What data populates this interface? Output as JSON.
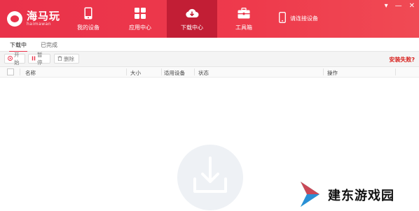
{
  "brand": {
    "name": "海马玩",
    "sub": "haimawan"
  },
  "nav": {
    "my_device": "我的设备",
    "app_center": "应用中心",
    "download_center": "下载中心",
    "toolbox": "工具箱",
    "connect_device": "请连接设备"
  },
  "window": {
    "menu_glyph": "▾",
    "minimize_glyph": "—",
    "close_glyph": "✕"
  },
  "tabs": {
    "downloading": "下载中",
    "completed": "已完成"
  },
  "toolbar": {
    "start": "开始",
    "pause": "暂停",
    "delete": "删除",
    "install_failed": "安装失败?"
  },
  "table": {
    "columns": {
      "name": "名称",
      "size": "大小",
      "device": "适用设备",
      "status": "状态",
      "action": "操作"
    }
  },
  "watermark": {
    "text": "建东游戏园"
  },
  "colors": {
    "accent": "#e9324a",
    "active_tab_bg": "#c21e35",
    "error_red": "#d8201c"
  },
  "icons": [
    "phone-icon",
    "apps-grid-icon",
    "cloud-download-icon",
    "toolbox-icon",
    "phone-outline-icon",
    "download-tray-icon"
  ]
}
